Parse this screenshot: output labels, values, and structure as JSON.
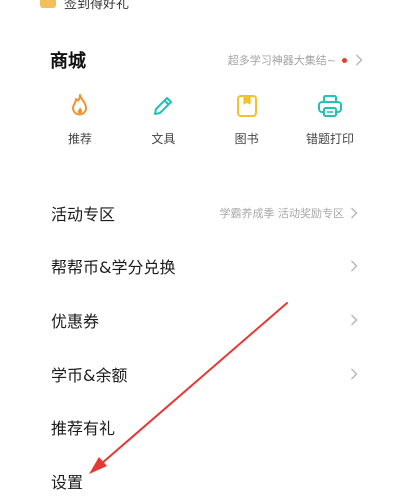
{
  "top_banner": {
    "text": "签到得好礼"
  },
  "shop": {
    "title": "商城",
    "promo_text": "超多学习神器大集结~",
    "items": [
      {
        "label": "推荐",
        "icon": "flame-icon",
        "color": "#f0932b"
      },
      {
        "label": "文具",
        "icon": "pencil-icon",
        "color": "#24c2b4"
      },
      {
        "label": "图书",
        "icon": "book-icon",
        "color": "#f2c12e"
      },
      {
        "label": "错题打印",
        "icon": "printer-icon",
        "color": "#24c2b4"
      }
    ]
  },
  "menu": {
    "items": [
      {
        "label": "活动专区",
        "sub": "学霸养成季 活动奖励专区",
        "chevron": true
      },
      {
        "label": "帮帮币&学分兑换",
        "sub": "",
        "chevron": true
      },
      {
        "label": "优惠券",
        "sub": "",
        "chevron": true
      },
      {
        "label": "学币&余额",
        "sub": "",
        "chevron": true
      },
      {
        "label": "推荐有礼",
        "sub": "",
        "chevron": false
      },
      {
        "label": "设置",
        "sub": "",
        "chevron": false
      }
    ]
  },
  "colors": {
    "annotation_arrow": "#e53935",
    "promo_dot": "#ea3b2f"
  }
}
